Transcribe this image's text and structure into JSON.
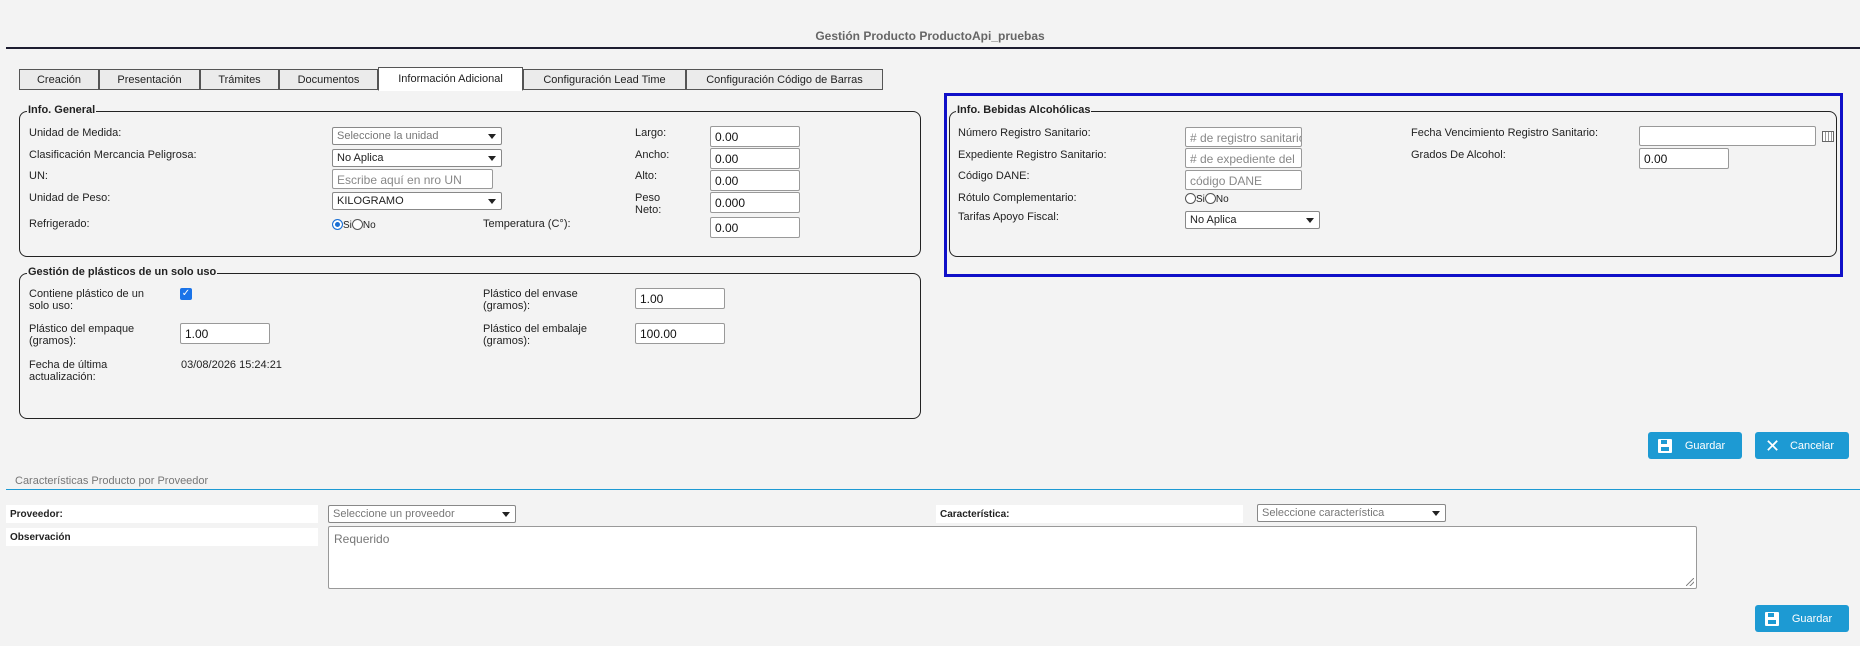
{
  "page": {
    "title": "Gestión Producto ProductoApi_pruebas"
  },
  "tabs": [
    {
      "label": "Creación"
    },
    {
      "label": "Presentación"
    },
    {
      "label": "Trámites"
    },
    {
      "label": "Documentos"
    },
    {
      "label": "Información Adicional",
      "active": true
    },
    {
      "label": "Configuración Lead Time"
    },
    {
      "label": "Configuración Código de Barras"
    }
  ],
  "info_general": {
    "legend": "Info. General",
    "unidad_medida": {
      "label": "Unidad de Medida:",
      "value": "Seleccione la unidad"
    },
    "clasificacion": {
      "label": "Clasificación Mercancia Peligrosa:",
      "value": "No Aplica"
    },
    "un": {
      "label": "UN:",
      "placeholder": "Escribe aquí en nro UN"
    },
    "unidad_peso": {
      "label": "Unidad de Peso:",
      "value": "KILOGRAMO"
    },
    "refrigerado": {
      "label": "Refrigerado:",
      "opt_si": "Si",
      "opt_no": "No",
      "selected": "Si"
    },
    "largo": {
      "label": "Largo:",
      "value": "0.00"
    },
    "ancho": {
      "label": "Ancho:",
      "value": "0.00"
    },
    "alto": {
      "label": "Alto:",
      "value": "0.00"
    },
    "peso_neto": {
      "label1": "Peso",
      "label2": "Neto:",
      "value": "0.000"
    },
    "temperatura": {
      "label": "Temperatura (C°):",
      "value": "0.00"
    }
  },
  "plasticos": {
    "legend": "Gestión de plásticos de un solo uso",
    "contiene": {
      "label1": "Contiene plástico de un",
      "label2": "solo uso:",
      "checked": true
    },
    "empaque": {
      "label1": "Plástico del empaque",
      "label2": "(gramos):",
      "value": "1.00"
    },
    "fecha": {
      "label1": "Fecha de última",
      "label2": "actualización:",
      "value": "03/08/2026 15:24:21"
    },
    "envase": {
      "label1": "Plástico del envase",
      "label2": "(gramos):",
      "value": "1.00"
    },
    "embalaje": {
      "label1": "Plástico del embalaje",
      "label2": "(gramos):",
      "value": "100.00"
    }
  },
  "bebidas": {
    "legend": "Info. Bebidas Alcohólicas",
    "registro": {
      "label": "Número Registro Sanitario:",
      "placeholder": "# de registro sanitario"
    },
    "expediente": {
      "label": "Expediente Registro Sanitario:",
      "placeholder": "# de expediente del"
    },
    "dane": {
      "label": "Código DANE:",
      "placeholder": "código DANE"
    },
    "rotulo": {
      "label": "Rótulo Complementario:",
      "opt_si": "Si",
      "opt_no": "No"
    },
    "tarifas": {
      "label": "Tarifas Apoyo Fiscal:",
      "value": "No Aplica"
    },
    "vencimiento": {
      "label": "Fecha Vencimiento Registro Sanitario:",
      "value": ""
    },
    "grados": {
      "label": "Grados De Alcohol:",
      "value": "0.00"
    }
  },
  "actions": {
    "guardar": "Guardar",
    "cancelar": "Cancelar"
  },
  "proveedor_section": {
    "title": "Características Producto por Proveedor",
    "proveedor": {
      "label": "Proveedor:",
      "value": "Seleccione un proveedor"
    },
    "caracteristica": {
      "label": "Característica:",
      "value": "Seleccione característica"
    },
    "observacion": {
      "label": "Observación",
      "placeholder": "Requerido"
    },
    "guardar": "Guardar"
  },
  "colors": {
    "accent": "#1d9ad3",
    "highlight": "#1010c8"
  }
}
